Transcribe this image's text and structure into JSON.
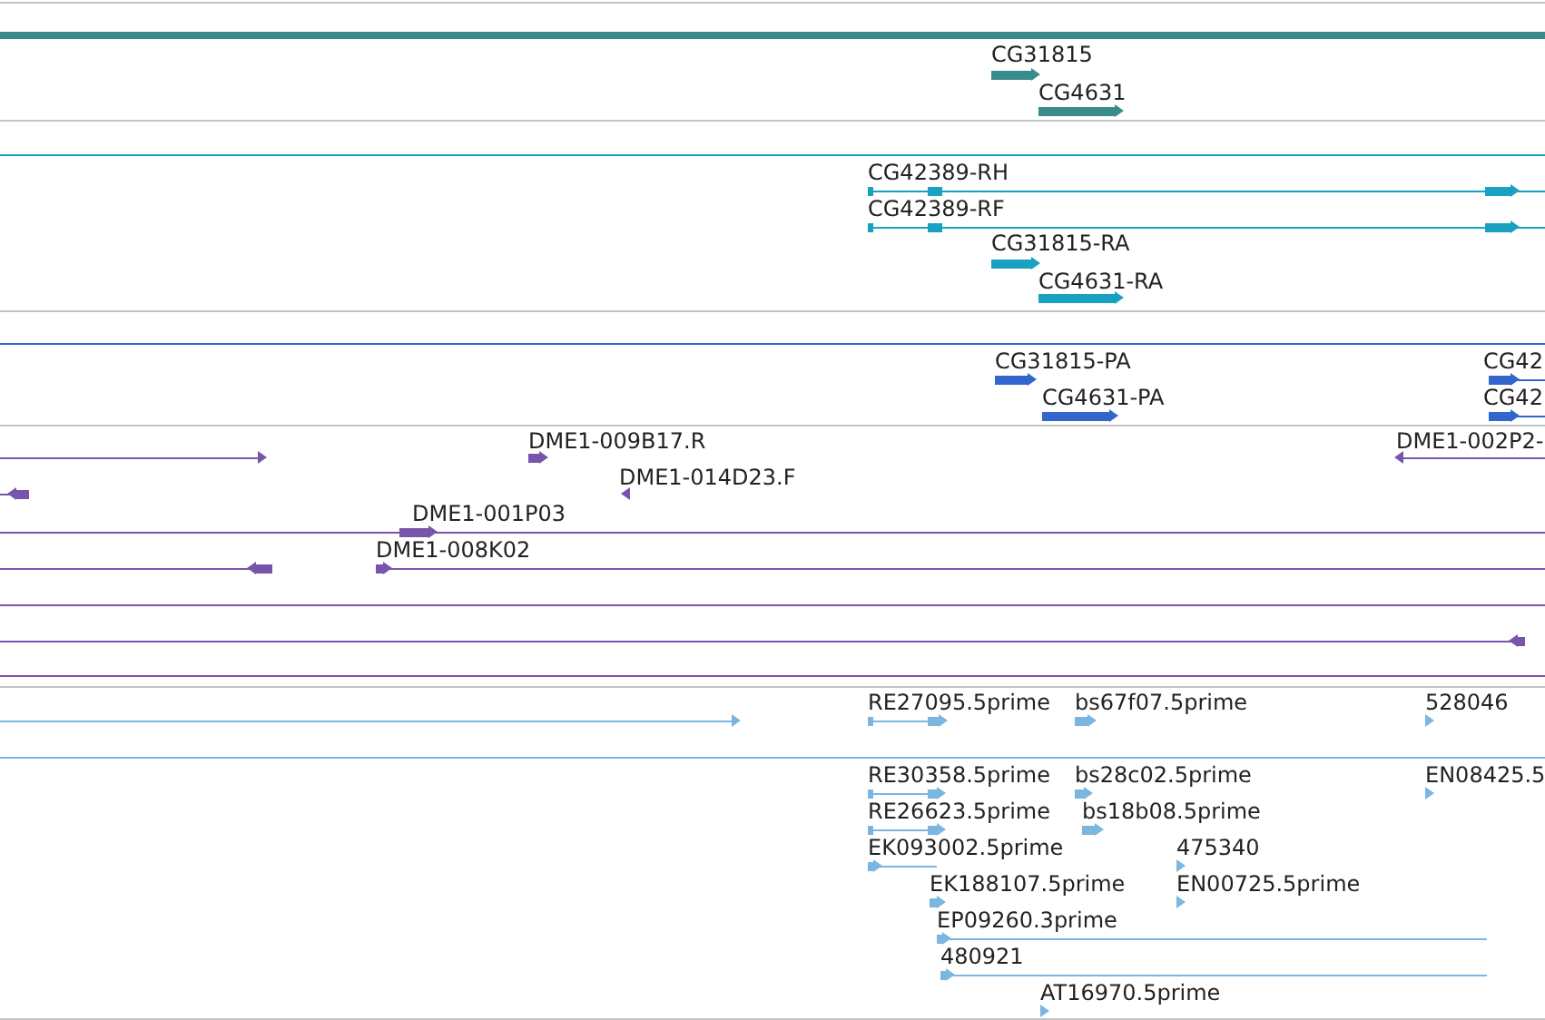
{
  "tracks": [
    {
      "color": "#3a8c8c",
      "features": [
        {
          "kind": "span"
        },
        {
          "label": "CG31815",
          "kind": "arrow",
          "reverse": false
        },
        {
          "label": "CG4631",
          "kind": "arrow",
          "reverse": false
        }
      ]
    },
    {
      "color": "#1aa0c0",
      "features": [
        {
          "kind": "span"
        },
        {
          "label": "CG42389-RH",
          "kind": "arrow",
          "reverse": false
        },
        {
          "label": "CG42389-RF",
          "kind": "arrow",
          "reverse": false
        },
        {
          "label": "CG31815-RA",
          "kind": "arrow",
          "reverse": false
        },
        {
          "label": "CG4631-RA",
          "kind": "arrow",
          "reverse": false
        }
      ]
    },
    {
      "color": "#3366cc",
      "features": [
        {
          "kind": "span"
        },
        {
          "label": "CG31815-PA",
          "kind": "arrow",
          "reverse": false
        },
        {
          "label": "CG4631-PA",
          "kind": "arrow",
          "reverse": false
        },
        {
          "label": "CG42",
          "kind": "arrow",
          "reverse": false
        },
        {
          "label": "CG42",
          "kind": "arrow",
          "reverse": false
        }
      ]
    },
    {
      "color": "#7755aa",
      "features": [
        {
          "kind": "arrow",
          "reverse": false
        },
        {
          "label": "DME1-009B17.R",
          "kind": "arrow",
          "reverse": false
        },
        {
          "label": "DME1-002P2-",
          "kind": "arrow",
          "reverse": true
        },
        {
          "label": "DME1-014D23.F",
          "kind": "arrow",
          "reverse": true
        },
        {
          "kind": "arrow",
          "reverse": true
        },
        {
          "label": "DME1-001P03",
          "kind": "arrow",
          "reverse": false
        },
        {
          "kind": "arrow",
          "reverse": true
        },
        {
          "label": "DME1-008K02",
          "kind": "arrow",
          "reverse": false
        },
        {
          "kind": "span"
        },
        {
          "kind": "arrow",
          "reverse": true
        },
        {
          "kind": "span"
        }
      ]
    },
    {
      "color": "#7ab6e0",
      "features": [
        {
          "kind": "arrow",
          "reverse": false
        },
        {
          "label": "RE27095.5prime",
          "kind": "arrow",
          "reverse": false
        },
        {
          "label": "bs67f07.5prime",
          "kind": "arrow",
          "reverse": false
        },
        {
          "label": "528046",
          "kind": "arrow",
          "reverse": false
        },
        {
          "kind": "span"
        },
        {
          "label": "RE30358.5prime",
          "kind": "arrow",
          "reverse": false
        },
        {
          "label": "bs28c02.5prime",
          "kind": "arrow",
          "reverse": false
        },
        {
          "label": "EN08425.5",
          "kind": "arrow",
          "reverse": false
        },
        {
          "label": "RE26623.5prime",
          "kind": "arrow",
          "reverse": false
        },
        {
          "label": "bs18b08.5prime",
          "kind": "arrow",
          "reverse": false
        },
        {
          "label": "EK093002.5prime",
          "kind": "arrow",
          "reverse": false
        },
        {
          "label": "475340",
          "kind": "arrow",
          "reverse": false
        },
        {
          "label": "EK188107.5prime",
          "kind": "arrow",
          "reverse": false
        },
        {
          "label": "EN00725.5prime",
          "kind": "arrow",
          "reverse": false
        },
        {
          "label": "EP09260.3prime",
          "kind": "arrow",
          "reverse": false
        },
        {
          "label": "480921",
          "kind": "arrow",
          "reverse": false
        },
        {
          "label": "AT16970.5prime",
          "kind": "arrow",
          "reverse": false
        }
      ]
    }
  ]
}
